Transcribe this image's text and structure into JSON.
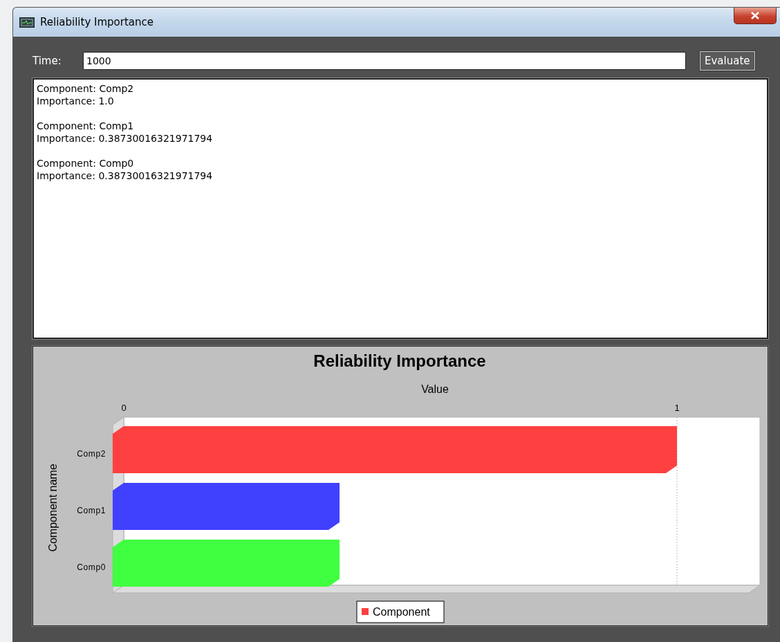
{
  "window": {
    "title": "Reliability Importance"
  },
  "time_field": {
    "label": "Time:",
    "value": "1000"
  },
  "evaluate_button": {
    "label": "Evaluate"
  },
  "results": [
    {
      "component": "Component: Comp2",
      "importance": "Importance: 1.0"
    },
    {
      "component": "Component: Comp1",
      "importance": "Importance: 0.38730016321971794"
    },
    {
      "component": "Component: Comp0",
      "importance": "Importance: 0.38730016321971794"
    }
  ],
  "chart": {
    "chart_data": {
      "type": "bar",
      "orientation": "horizontal",
      "title": "Reliability Importance",
      "xlabel": "Value",
      "ylabel": "Component name",
      "categories": [
        "Comp2",
        "Comp1",
        "Comp0"
      ],
      "series": [
        {
          "name": "Component",
          "color": "#ff4040",
          "values": [
            1.0,
            null,
            null
          ]
        },
        {
          "color": "#4040ff",
          "values": [
            null,
            0.39,
            null
          ]
        },
        {
          "color": "#40ff40",
          "values": [
            null,
            null,
            0.39
          ]
        }
      ],
      "xlim": [
        0,
        1.15
      ],
      "xticks": [
        0,
        1
      ]
    }
  }
}
